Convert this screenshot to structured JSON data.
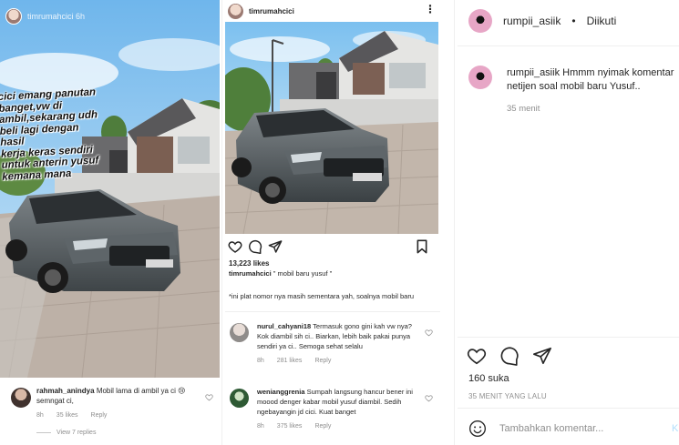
{
  "story": {
    "username": "timrumahcici 6h",
    "overlay_lines": [
      "cici emang panutan",
      "banget,vw di",
      "ambil,sekarang udh",
      "beli lagi dengan hasil",
      "kerja keras sendiri",
      "untuk anterin yusuf",
      "kemana mana"
    ],
    "comment": {
      "username": "rahmah_anindya",
      "text": "Mobil lama di ambil ya ci 😢semngat ci,",
      "time": "8h",
      "likes": "35 likes",
      "reply": "Reply"
    },
    "view_replies": "View 7 replies"
  },
  "post": {
    "username": "timrumahcici",
    "likes": "13,223 likes",
    "caption_user": "timrumahcici",
    "caption_text": "\" mobil baru yusuf \"",
    "subcaption": "*ini plat nomor nya masih sementara yah, soalnya mobil baru",
    "comments": [
      {
        "username": "nurul_cahyani18",
        "text": "Termasuk gono gini kah vw nya? Kok diambil sih ci.. Biarkan, lebih baik pakai punya sendiri ya ci.. Semoga sehat selalu",
        "time": "8h",
        "likes": "281 likes",
        "reply": "Reply"
      },
      {
        "username": "wenianggrenia",
        "text": "Sumpah langsung hancur bener ini moood denger kabar mobil yusuf diambil. Sedih ngebayangin jd cici. Kuat banget",
        "time": "8h",
        "likes": "375 likes",
        "reply": "Reply"
      }
    ],
    "colors": {
      "icon": "#262626",
      "muted": "#8e8e8e"
    }
  },
  "side": {
    "username": "rumpii_asiik",
    "separator": "•",
    "follow_label": "Diikuti",
    "caption_user": "rumpii_asiik",
    "caption_text": "Hmmm nyimak komentar",
    "caption_line2": "netijen soal mobil baru Yusuf..",
    "caption_time": "35 menit",
    "likes": "160 suka",
    "time_ago": "35 MENIT YANG LALU",
    "add_comment_placeholder": "Tambahkan komentar...",
    "post_label": "K"
  }
}
